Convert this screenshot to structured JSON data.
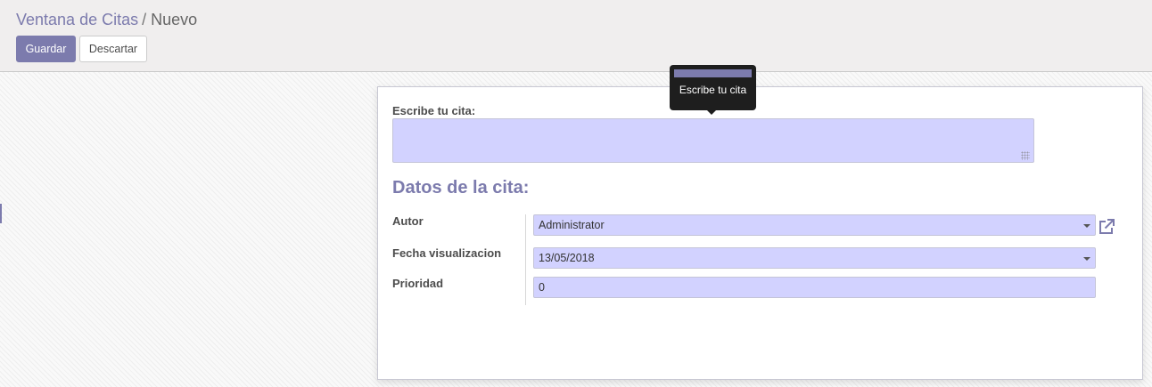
{
  "breadcrumb": {
    "parent": "Ventana de Citas",
    "separator": "/",
    "current": "Nuevo"
  },
  "toolbar": {
    "save_label": "Guardar",
    "discard_label": "Descartar"
  },
  "form": {
    "quote_label": "Escribe tu cita:",
    "quote_value": "",
    "section_title": "Datos de la cita:",
    "fields": [
      {
        "label": "Autor",
        "value": "Administrator"
      },
      {
        "label": "Fecha visualizacion",
        "value": "13/05/2018"
      },
      {
        "label": "Prioridad",
        "value": "0"
      }
    ]
  },
  "tooltip": {
    "text": "Escribe tu cita"
  },
  "icons": {
    "external_link": "external-link-icon",
    "dropdown": "caret-down-icon",
    "resize": "resize-grip-icon"
  },
  "colors": {
    "brand": "#7c7bad",
    "input_required": "#d2d2ff",
    "tooltip_bg": "#1e1e1e"
  }
}
